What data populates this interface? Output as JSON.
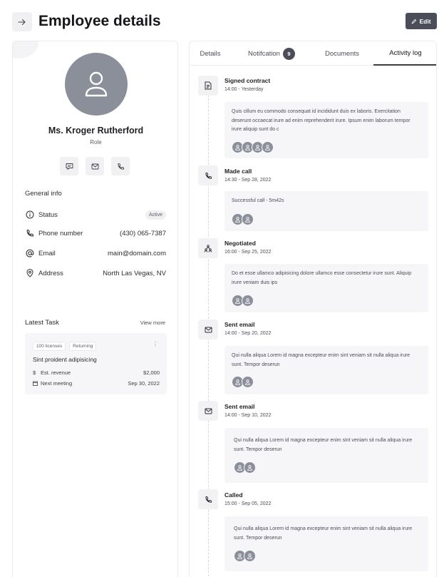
{
  "header": {
    "title": "Employee details",
    "edit_label": "Edit"
  },
  "profile": {
    "name": "Ms. Kroger Rutherford",
    "role": "Role",
    "actions": [
      "message-icon",
      "mail-icon",
      "phone-icon"
    ]
  },
  "general_info": {
    "title": "General info",
    "status_label": "Status",
    "status_value": "Active",
    "phone_label": "Phone number",
    "phone_value": "(430) 065-7387",
    "email_label": "Email",
    "email_value": "main@domain.com",
    "address_label": "Address",
    "address_value": "North Las Vegas, NV"
  },
  "latest_task": {
    "title": "Latest Task",
    "view_more": "View more",
    "tags": [
      "100 licenses",
      "Returning"
    ],
    "name": "Sint proident adipisicing",
    "revenue_label": "Est. revenue",
    "revenue_value": "$2,000",
    "meeting_label": "Next meeting",
    "meeting_value": "Sep 30, 2022"
  },
  "tabs": {
    "details": "Details",
    "notification": "Notifcation",
    "notification_count": "9",
    "documents": "Documents",
    "activity": "Activity log",
    "active": "Activity log"
  },
  "activity": [
    {
      "icon": "document-icon",
      "title": "Signed contract",
      "time": "14:00 - Yesterday",
      "text": "Quis cillum eu commodo consequat id incididunt duis ex laboris. Exercitation deserunt occaecat irure ad enim reprehenderit irure. Ipsum enim laborum tempor irure aliquip sunt do c",
      "avatars": 4
    },
    {
      "icon": "phone-icon",
      "title": "Made call",
      "time": "14:30 - Sep 28, 2022",
      "text": "Successful call - 5m42s",
      "avatars": 2
    },
    {
      "icon": "people-icon",
      "title": "Negotiated",
      "time": "16:00 - Sep 25, 2022",
      "text": "Do et esse ullamco adipisicing dolore ullamco esse consectetur irure sunt. Aliquip irure veniam duis ips",
      "avatars": 2
    },
    {
      "icon": "mail-icon",
      "title": "Sent email",
      "time": "14:00 - Sep 20, 2022",
      "text": "Qui nulla aliqua Lorem id magna excepteur enim sint veniam sit nulla aliqua irure sunt. Tempor deserun",
      "avatars": 2
    },
    {
      "icon": "mail-icon",
      "title": "Sent email",
      "time": "14:00 - Sep 10, 2022",
      "text": "Qui nulla aliqua Lorem id magna excepteur enim sint veniam sit nulla aliqua irure sunt. Tempor deserun",
      "avatars": 2
    },
    {
      "icon": "phone-icon",
      "title": "Called",
      "time": "15:00 - Sep 05, 2022",
      "text": "Qui nulla aliqua Lorem id magna excepteur enim sint veniam sit nulla aliqua irure sunt. Tempor deserun",
      "avatars": 2
    }
  ]
}
